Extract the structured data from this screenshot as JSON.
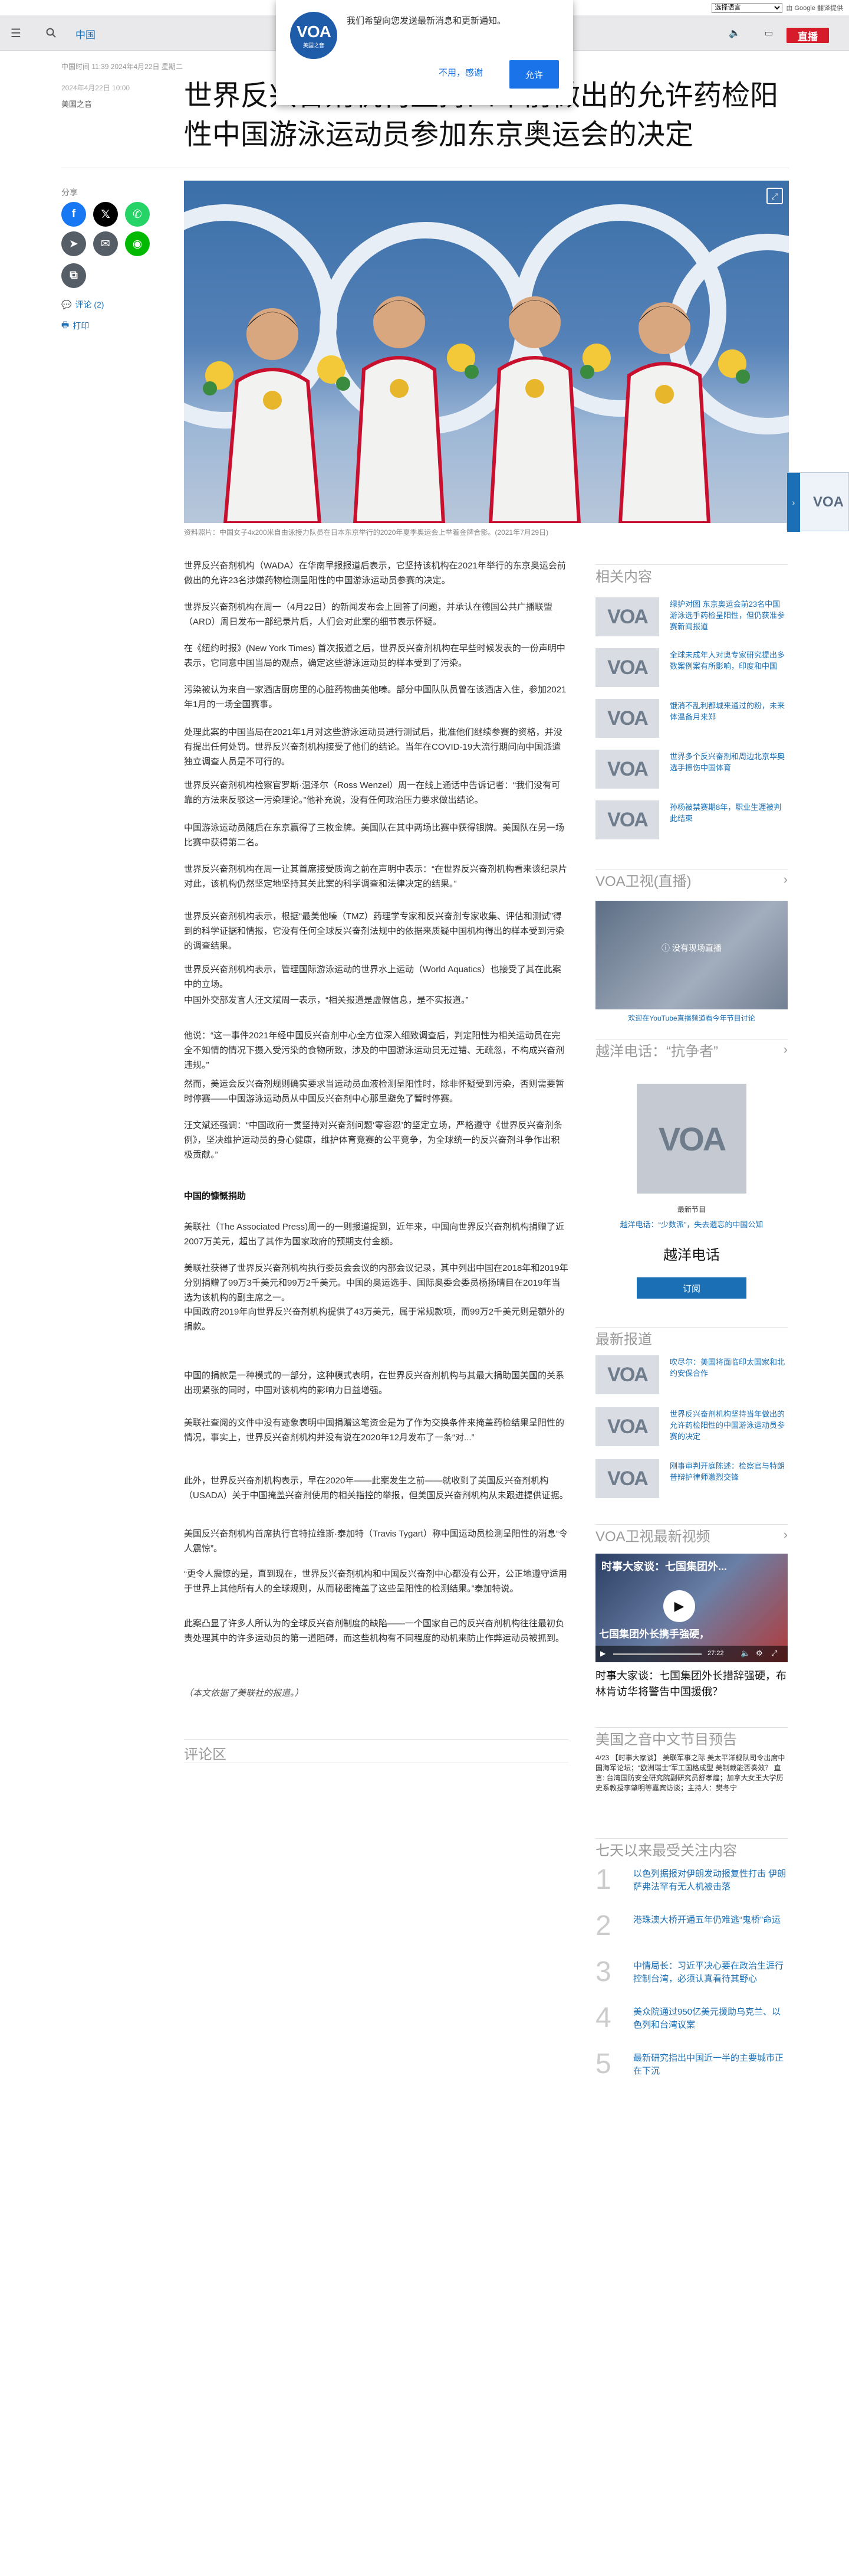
{
  "header": {
    "translate_select": "选择语言",
    "translate_powered": "由 Google 翻译提供",
    "section": "中国",
    "live_label": "直播"
  },
  "notification": {
    "logo_text": "VOA",
    "logo_sub": "美国之音",
    "message": "我们希望向您发送最新消息和更新通知。",
    "decline_label": "不用，感谢",
    "accept_label": "允许"
  },
  "article": {
    "dateline": "中国时间 11:39 2024年4月22日 星期二",
    "date": "2024年4月22日 10:00",
    "byline": "美国之音",
    "title": "世界反兴奋剂机构坚持四年前做出的允许药检阳性中国游泳运动员参加东京奥运会的决定",
    "caption": "资料照片：中国女子4x200米自由泳接力队员在日本东京举行的2020年夏季奥运会上举着金牌合影。(2021年7月29日)",
    "paragraphs": [
      "世界反兴奋剂机构（WADA）在华南早报报道后表示，它坚持该机构在2021年举行的东京奥运会前做出的允许23名涉嫌药物检测呈阳性的中国游泳运动员参赛的决定。",
      "世界反兴奋剂机构在周一（4月22日）的新闻发布会上回答了问题，并承认在德国公共广播联盟（ARD）周日发布一部纪录片后，人们会对此案的细节表示怀疑。",
      "在《纽约时报》(New York Times) 首次报道之后，世界反兴奋剂机构在早些时候发表的一份声明中表示，它同意中国当局的观点，确定这些游泳运动员的样本受到了污染。",
      "污染被认为来自一家酒店厨房里的心脏药物曲美他嗪。部分中国队队员曾在该酒店入住，参加2021年1月的一场全国赛事。",
      "处理此案的中国当局在2021年1月对这些游泳运动员进行测试后，批准他们继续参赛的资格，并没有提出任何处罚。世界反兴奋剂机构接受了他们的结论。当年在COVID-19大流行期间向中国派遣独立调查人员是不可行的。",
      "世界反兴奋剂机构检察官罗斯·温泽尔（Ross Wenzel）周一在线上通话中告诉记者：“我们没有可靠的方法来反驳这一污染理论。”他补充说，没有任何政治压力要求做出结论。",
      "中国游泳运动员随后在东京赢得了三枚金牌。美国队在其中两场比赛中获得银牌。美国队在另一场比赛中获得第二名。",
      "世界反兴奋剂机构在周一让其首席接受质询之前在声明中表示：“在世界反兴奋剂机构看来该纪录片对此，该机构仍然坚定地坚持其关此案的科学调查和法律决定的结果。”",
      "世界反兴奋剂机构表示，根据“最美他嗪（TMZ）药理学专家和反兴奋剂专家收集、评估和测试”得到的科学证据和情报，它没有任何全球反兴奋剂法规中的依据来质疑中国机构得出的样本受到污染的调查结果。",
      "世界反兴奋剂机构表示，管理国际游泳运动的世界水上运动（World Aquatics）也接受了其在此案中的立场。",
      "中国外交部发言人汪文斌周一表示，“相关报道是虚假信息，是不实报道。”",
      "他说：“这一事件2021年经中国反兴奋剂中心全方位深入细致调查后，判定阳性为相关运动员在完全不知情的情况下摄入受污染的食物所致，涉及的中国游泳运动员无过错、无疏忽，不构成兴奋剂违规。”",
      "然而，美运会反兴奋剂规则确实要求当运动员血液检测呈阳性时，除非怀疑受到污染，否则需要暂时停赛——中国游泳运动员从中国反兴奋剂中心那里避免了暂时停赛。",
      "汪文斌还强调：“中国政府一贯坚持对兴奋剂问题‘零容忍’的坚定立场，严格遵守《世界反兴奋剂条例》，坚决维护运动员的身心健康，维护体育竞赛的公平竞争，为全球统一的反兴奋剂斗争作出积极贡献。”",
      "中国的慷慨捐助",
      "美联社（The Associated Press)周一的一则报道提到，近年来，中国向世界反兴奋剂机构捐赠了近2007万美元，超出了其作为国家政府的预期支付金额。",
      "美联社获得了世界反兴奋剂机构执行委员会会议的内部会议记录，其中列出中国在2018年和2019年分别捐赠了99万3千美元和99万2千美元。中国的奥运选手、国际奥委会委员杨扬晴目在2019年当选为该机构的副主席之一。",
      "中国政府2019年向世界反兴奋剂机构提供了43万美元，属于常规款项，而99万2千美元则是额外的捐款。",
      "中国的捐款是一种模式的一部分，这种模式表明，在世界反兴奋剂机构与其最大捐助国美国的关系出现紧张的同时，中国对该机构的影响力日益增强。",
      "美联社查阅的文件中没有迹象表明中国捐赠这笔资金是为了作为交换条件来掩盖药检结果呈阳性的情况，事实上，世界反兴奋剂机构并没有说在2020年12月发布了一条“对...”",
      "此外，世界反兴奋剂机构表示，早在2020年——此案发生之前——就收到了美国反兴奋剂机构（USADA）关于中国掩盖兴奋剂使用的相关指控的举报，但美国反兴奋剂机构从未跟进提供证据。",
      "美国反兴奋剂机构首席执行官特拉维斯·泰加特（Travis Tygart）称中国运动员检测呈阳性的消息“令人震惊”。",
      "“更令人震惊的是，直到现在，世界反兴奋剂机构和中国反兴奋剂中心都没有公开，公正地遵守适用于世界上其他所有人的全球规则，从而秘密掩盖了这些呈阳性的检测结果。”泰加特说。",
      "此案凸显了许多人所认为的全球反兴奋剂制度的缺陷——一个国家自己的反兴奋剂机构往往最初负责处理其中的许多运动员的第一道阻碍，而这些机构有不同程度的动机来防止作弊运动员被抓到。",
      "（本文依据了美联社的报道。）"
    ]
  },
  "sidebar": {
    "share_label": "分享",
    "comments": "评论 (2)",
    "print": "打印"
  },
  "comments_heading": "评论区",
  "right": {
    "related_heading": "相关内容",
    "related": [
      "绿护对图 东京奥运会前23名中国游泳选手药检呈阳性，但仍获准参赛新闻报道",
      "全球未成年人对奥专家研究提出多数案例案有所影响，印度和中国",
      "饿消不乱利都城来通过的粉，未来体温备月来郑",
      "世界多个反兴奋剂和周边北京华奥选手擦伤中国体育",
      "孙杨被禁赛期8年，职业生涯被判此结束"
    ],
    "tv_heading": "VOA卫视(直播)",
    "tv_overlay": "没有现场直播",
    "tv_link": "欢迎在YouTube直播频道看今年节目讨论",
    "hotline_heading": "越洋电话：“抗争者”",
    "hotline_tag": "最新节目",
    "hotline_sub": "越洋电话：“少数派”，失去遗忘的中国公知",
    "hotline_title": "越洋电话",
    "subscribe_label": "订阅",
    "latest_heading": "最新报道",
    "latest": [
      "吹尽尔：美国将面临印太国家和北约安保合作",
      "世界反兴奋剂机构坚持当年做出的允许药检阳性的中国游泳运动员参赛的决定",
      "刚事审判开庭陈述：检察官与特朗普辩护律师激烈交锋"
    ],
    "video_heading": "VOA卫视最新视频",
    "video_overlay_title": "时事大家谈：七国集团外...",
    "video_banner": "七国集团外长携手強硬，",
    "video_time": "27:22",
    "video_caption": "时事大家谈：七国集团外长措辞强硬，布林肯访华将警告中国援俄？",
    "program_heading": "美国之音中文节目预告",
    "program_text": "4/23 【时事大家谈】 美联军事之际 美太平洋舰队司令出席中国海军论坛；“欧洲瑞士”军工国格成型 美制裁能否奏效？ 直言: 台湾国防安全研究院副研究员舒孝煌；加拿大女王大学历史系教授李肇明等嘉宾访谈；主持人：樊冬宁",
    "top_heading": "七天以来最受关注内容",
    "top": [
      "以色列据报对伊朗发动报复性打击 伊朗萨弗法罕有无人机被击落",
      "港珠澳大桥开通五年仍难逃“鬼桥”命运",
      "中情局长：习近平决心要在政治生涯行控制台湾，必须认真看待其野心",
      "美众院通过950亿美元援助乌克兰、以色列和台湾议案",
      "最新研究指出中国近一半的主要城市正在下沉"
    ]
  },
  "colors": {
    "accent": "#1a6fb5",
    "live": "#d61b2a",
    "brand": "#1e5ba8",
    "facebook": "#1877f2",
    "x": "#000000",
    "whatsapp": "#25d366",
    "email": "#555d66",
    "line": "#00b900",
    "telegram": "#555d66"
  },
  "icons": [
    "menu-icon",
    "search-icon",
    "volume-icon",
    "tv-icon",
    "expand-icon",
    "comment-icon",
    "print-icon",
    "chevron-right-icon",
    "play-icon"
  ]
}
